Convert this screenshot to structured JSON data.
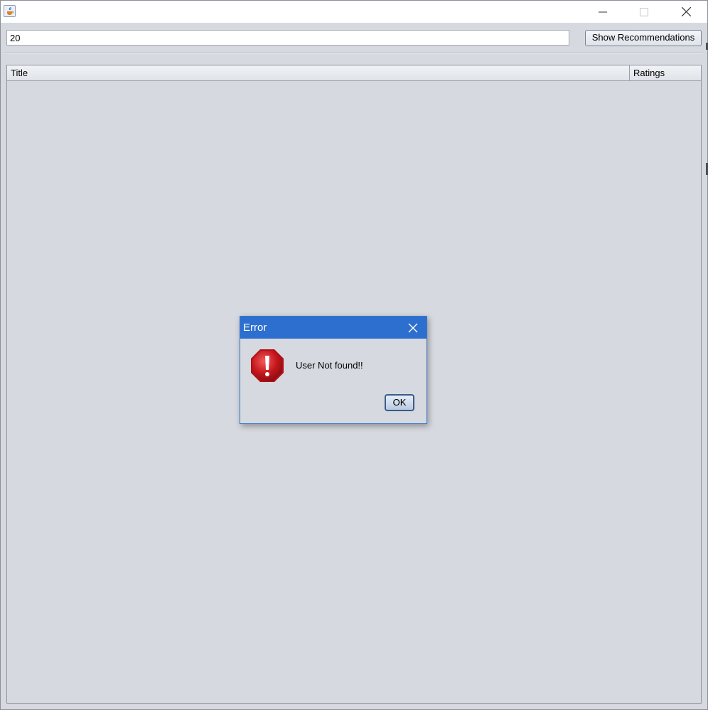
{
  "toolbar": {
    "user_input_value": "20",
    "show_button_label": "Show Recommendations"
  },
  "table": {
    "columns": [
      "Title",
      "Ratings"
    ],
    "rows": []
  },
  "dialog": {
    "title": "Error",
    "message": "User Not found!!",
    "ok_label": "OK",
    "icon": "error-icon"
  },
  "colors": {
    "dialog_titlebar": "#2d6fce",
    "background": "#d6d9df",
    "error_icon": "#c4161c"
  }
}
